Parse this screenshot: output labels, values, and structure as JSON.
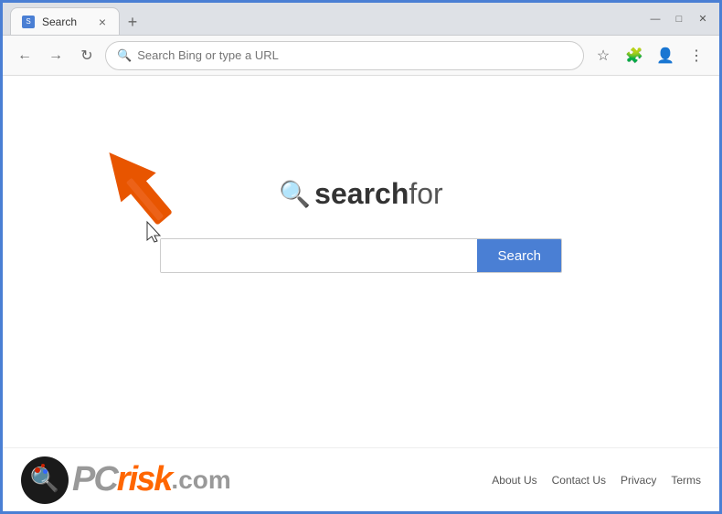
{
  "browser": {
    "tab": {
      "title": "Search",
      "close_label": "×"
    },
    "new_tab_label": "+",
    "window_controls": {
      "minimize": "—",
      "maximize": "□",
      "close": "✕"
    },
    "toolbar": {
      "back_icon": "←",
      "forward_icon": "→",
      "refresh_icon": "↻",
      "address_placeholder": "Search Bing or type a URL",
      "star_icon": "☆",
      "extensions_icon": "🧩",
      "profile_icon": "👤",
      "menu_icon": "⋮"
    }
  },
  "page": {
    "logo": {
      "icon": "🔍",
      "brand": "searchfor"
    },
    "search": {
      "placeholder": "",
      "button_label": "Search"
    },
    "footer": {
      "pc_text": "PC",
      "risk_text": "risk",
      "domain_text": ".com",
      "links": [
        "About Us",
        "Contact Us",
        "Privacy",
        "Terms"
      ]
    }
  }
}
